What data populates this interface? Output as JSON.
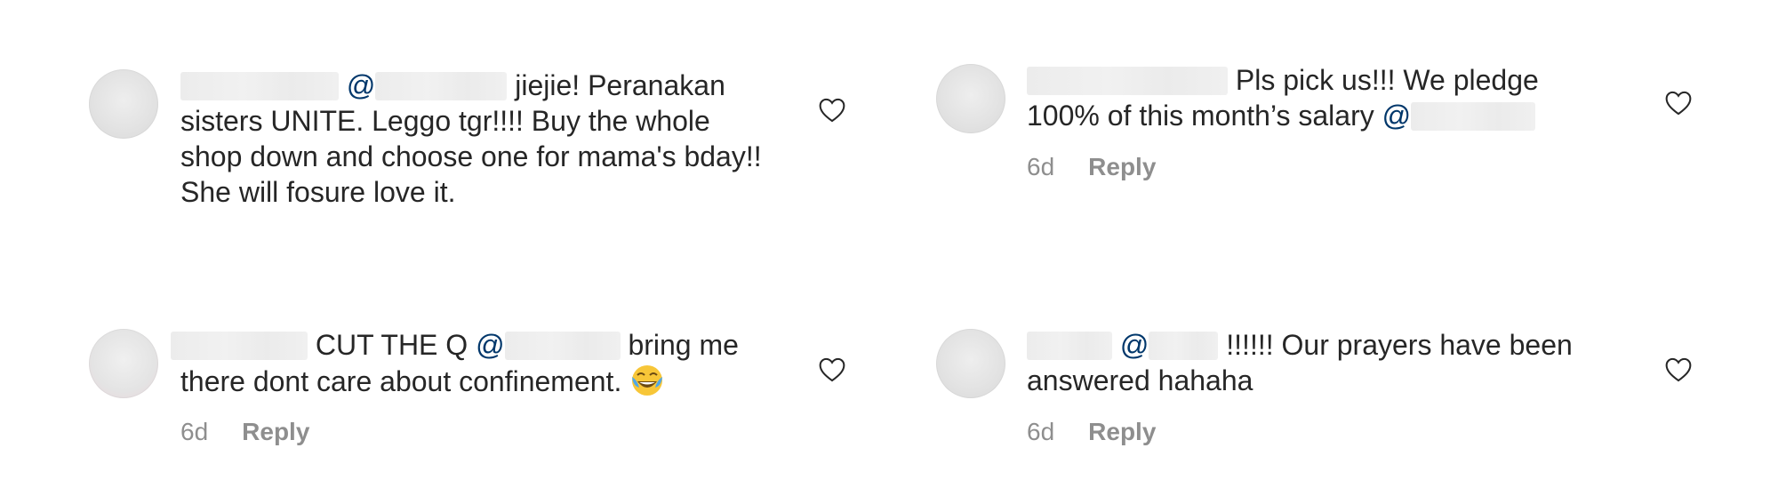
{
  "comments": [
    {
      "mention_prefix": "@",
      "text": "jiejie! Peranakan sisters UNITE. Leggo tgr!!!! Buy the whole shop down and choose one for mama's bday!! She will fosure love it."
    },
    {
      "text_line1": "Pls pick us!!! We pledge",
      "text_line2": "100% of this month’s salary",
      "mention_prefix": "@",
      "time": "6d",
      "reply_label": "Reply"
    },
    {
      "text_part1": "CUT THE Q",
      "mention_prefix": "@",
      "text_part2": "bring me",
      "text_line2": "there dont care about confinement.",
      "emoji": "face-with-tears-of-joy",
      "time": "6d",
      "reply_label": "Reply"
    },
    {
      "mention_prefix": "@",
      "text_part1": "!!!!!! Our prayers have been",
      "text_line2": "answered hahaha",
      "time": "6d",
      "reply_label": "Reply"
    }
  ],
  "icons": {
    "like": "heart-outline-icon"
  },
  "colors": {
    "text": "#262626",
    "mention": "#00376b",
    "meta": "#8e8e8e"
  }
}
